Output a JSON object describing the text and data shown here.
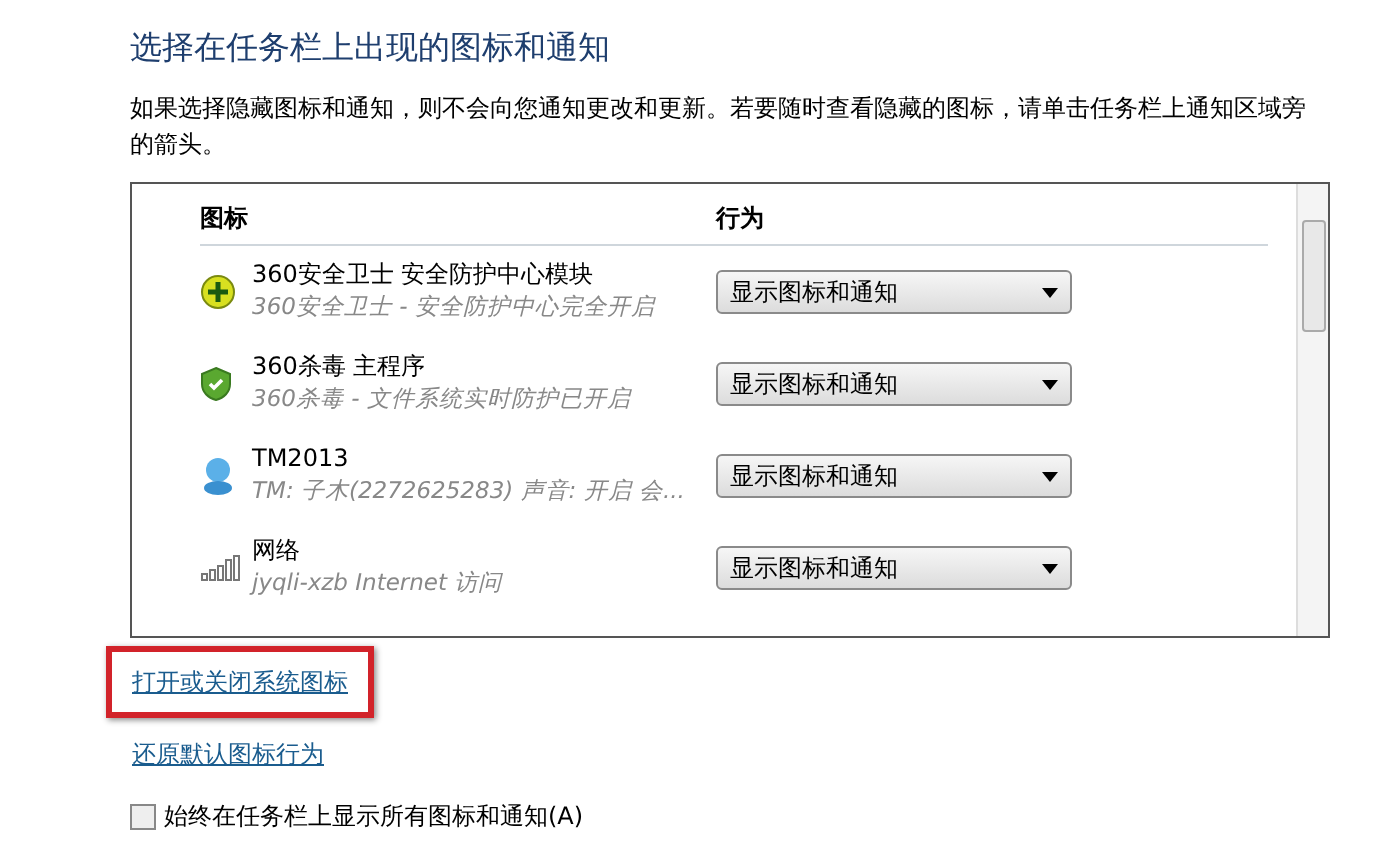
{
  "title": "选择在任务栏上出现的图标和通知",
  "description": "如果选择隐藏图标和通知，则不会向您通知更改和更新。若要随时查看隐藏的图标，请单击任务栏上通知区域旁的箭头。",
  "table": {
    "columns": [
      "图标",
      "行为"
    ],
    "rows": [
      {
        "kind": "guard",
        "name": "360安全卫士 安全防护中心模块",
        "detail": "360安全卫士 - 安全防护中心完全开启",
        "behavior": "显示图标和通知"
      },
      {
        "kind": "shield",
        "name": "360杀毒 主程序",
        "detail": "360杀毒 - 文件系统实时防护已开启",
        "behavior": "显示图标和通知"
      },
      {
        "kind": "messenger",
        "name": "TM2013",
        "detail": "TM: 子木(2272625283)  声音: 开启  会...",
        "behavior": "显示图标和通知"
      },
      {
        "kind": "network",
        "name": "网络",
        "detail": "jyqli-xzb Internet 访问",
        "behavior": "显示图标和通知"
      }
    ]
  },
  "links": [
    {
      "label": "打开或关闭系统图标",
      "highlighted": true
    },
    {
      "label": "还原默认图标行为",
      "highlighted": false
    }
  ],
  "always_show": {
    "label": "始终在任务栏上显示所有图标和通知(A)",
    "checked": false
  }
}
